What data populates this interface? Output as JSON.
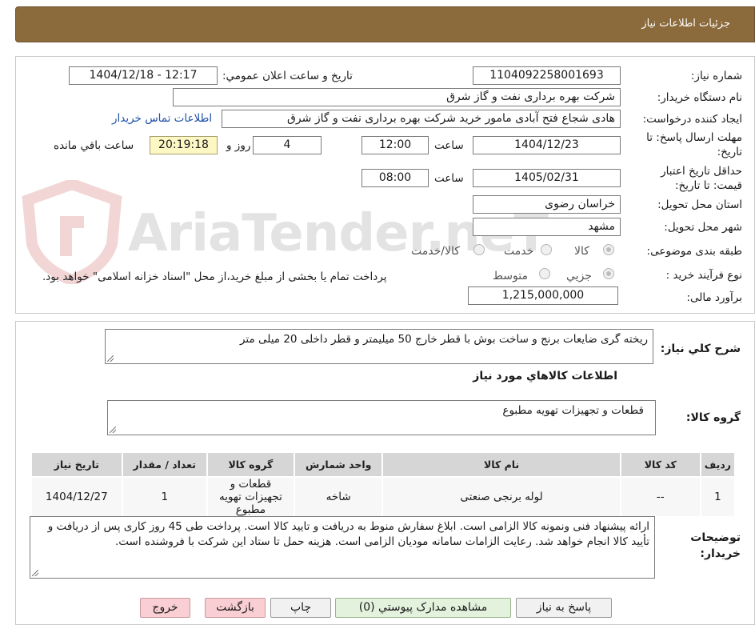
{
  "header": {
    "title": "جزئيات اطلاعات نياز"
  },
  "form": {
    "need_number": {
      "label": "شماره نياز:",
      "value": "1104092258001693"
    },
    "announce_datetime": {
      "label": "تاريخ و ساعت اعلان عمومي:",
      "value": "1404/12/18 - 12:17"
    },
    "buyer_org": {
      "label": "نام دستگاه خريدار:",
      "value": "شرکت بهره برداری نفت و گاز شرق"
    },
    "requester": {
      "label": "ايجاد کننده درخواست:",
      "value": "هادی شجاع فتح آبادی مامور خرید شرکت بهره برداری نفت و گاز شرق",
      "contact_link": "اطلاعات تماس خريدار"
    },
    "reply_deadline": {
      "label_line1": "مهلت ارسال پاسخ: تا",
      "label_line2": "تاريخ:",
      "date": "1404/12/23",
      "time_label": "ساعت",
      "time": "12:00",
      "days": "4",
      "days_label": "روز و",
      "remaining": "20:19:18",
      "remaining_label": "ساعت باقي مانده"
    },
    "validity": {
      "label_line1": "حداقل تاريخ اعتبار",
      "label_line2": "قيمت: تا تاريخ:",
      "date": "1405/02/31",
      "time_label": "ساعت",
      "time": "08:00"
    },
    "province": {
      "label": "استان محل تحويل:",
      "value": "خراسان رضوی"
    },
    "city": {
      "label": "شهر محل تحويل:",
      "value": "مشهد"
    },
    "category": {
      "label": "طبقه بندی موضوعی:",
      "options": [
        "کالا",
        "خدمت",
        "کالا/خدمت"
      ],
      "selected": "کالا"
    },
    "process": {
      "label": "نوع فرآيند خريد :",
      "options": [
        "جزيي",
        "متوسط"
      ],
      "selected": "جزيي",
      "note": "پرداخت تمام یا بخشی از مبلغ خرید،از محل \"اسناد خزانه اسلامی\" خواهد بود."
    },
    "budget": {
      "label": "برآورد مالی:",
      "value": "1,215,000,000"
    }
  },
  "description": {
    "label": "شرح کلي نياز:",
    "value": "ریخته گری ضایعات برنج و ساخت بوش با قطر خارج 50 میلیمتر و قطر داخلی 20 میلی متر"
  },
  "goods": {
    "section_title": "اطلاعات کالاهاي مورد نياز",
    "group_label": "گروه کالا:",
    "group_value": "قطعات و تجهيزات تهويه مطبوع",
    "columns": [
      "رديف",
      "کد کالا",
      "نام کالا",
      "واحد شمارش",
      "گروه کالا",
      "تعداد / مقدار",
      "تاريخ نياز"
    ],
    "rows": [
      [
        "1",
        "--",
        "لوله برنجی صنعتی",
        "شاخه",
        "قطعات و تجهيزات تهويه مطبوع",
        "1",
        "1404/12/27"
      ]
    ]
  },
  "buyer_notes": {
    "label_line1": "توضيحات",
    "label_line2": "خريدار:",
    "value": "ارائه پیشنهاد فنی ونمونه کالا الزامی است. ابلاغ سفارش منوط به دریافت و تایید کالا است. پرداخت طی  45 روز کاری پس از دریافت و تأیید کالا انجام خواهد شد. رعایت الزامات سامانه مودیان الزامی است. هزینه حمل تا ستاد این شرکت با فروشنده است."
  },
  "buttons": {
    "reply": "پاسخ به نياز",
    "attachments": "مشاهده مدارک پيوستي (0)",
    "print": "چاپ",
    "back": "بازگشت",
    "exit": "خروج"
  },
  "watermark": {
    "text": "AriaTender.neT"
  },
  "colors": {
    "header_bg": "#8b6a3c",
    "remaining_bg": "#fdf7c4",
    "exit_bg": "#f9cfd3",
    "attach_bg": "#e3f2dd",
    "link": "#1d4fa8"
  }
}
